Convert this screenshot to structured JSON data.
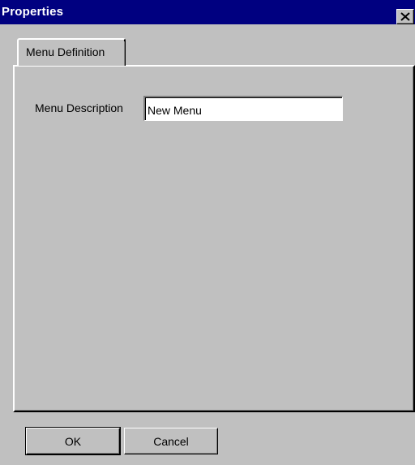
{
  "window": {
    "title": "Properties"
  },
  "icons": {
    "close": "close-icon"
  },
  "tabs": [
    {
      "label": "Menu Definition",
      "selected": true
    }
  ],
  "form": {
    "menu_description": {
      "label": "Menu Description",
      "value": "New Menu"
    }
  },
  "buttons": {
    "ok_label": "OK",
    "cancel_label": "Cancel"
  },
  "colors": {
    "title_bar": "#000080",
    "face": "#c0c0c0",
    "input_bg": "#ffffff"
  }
}
